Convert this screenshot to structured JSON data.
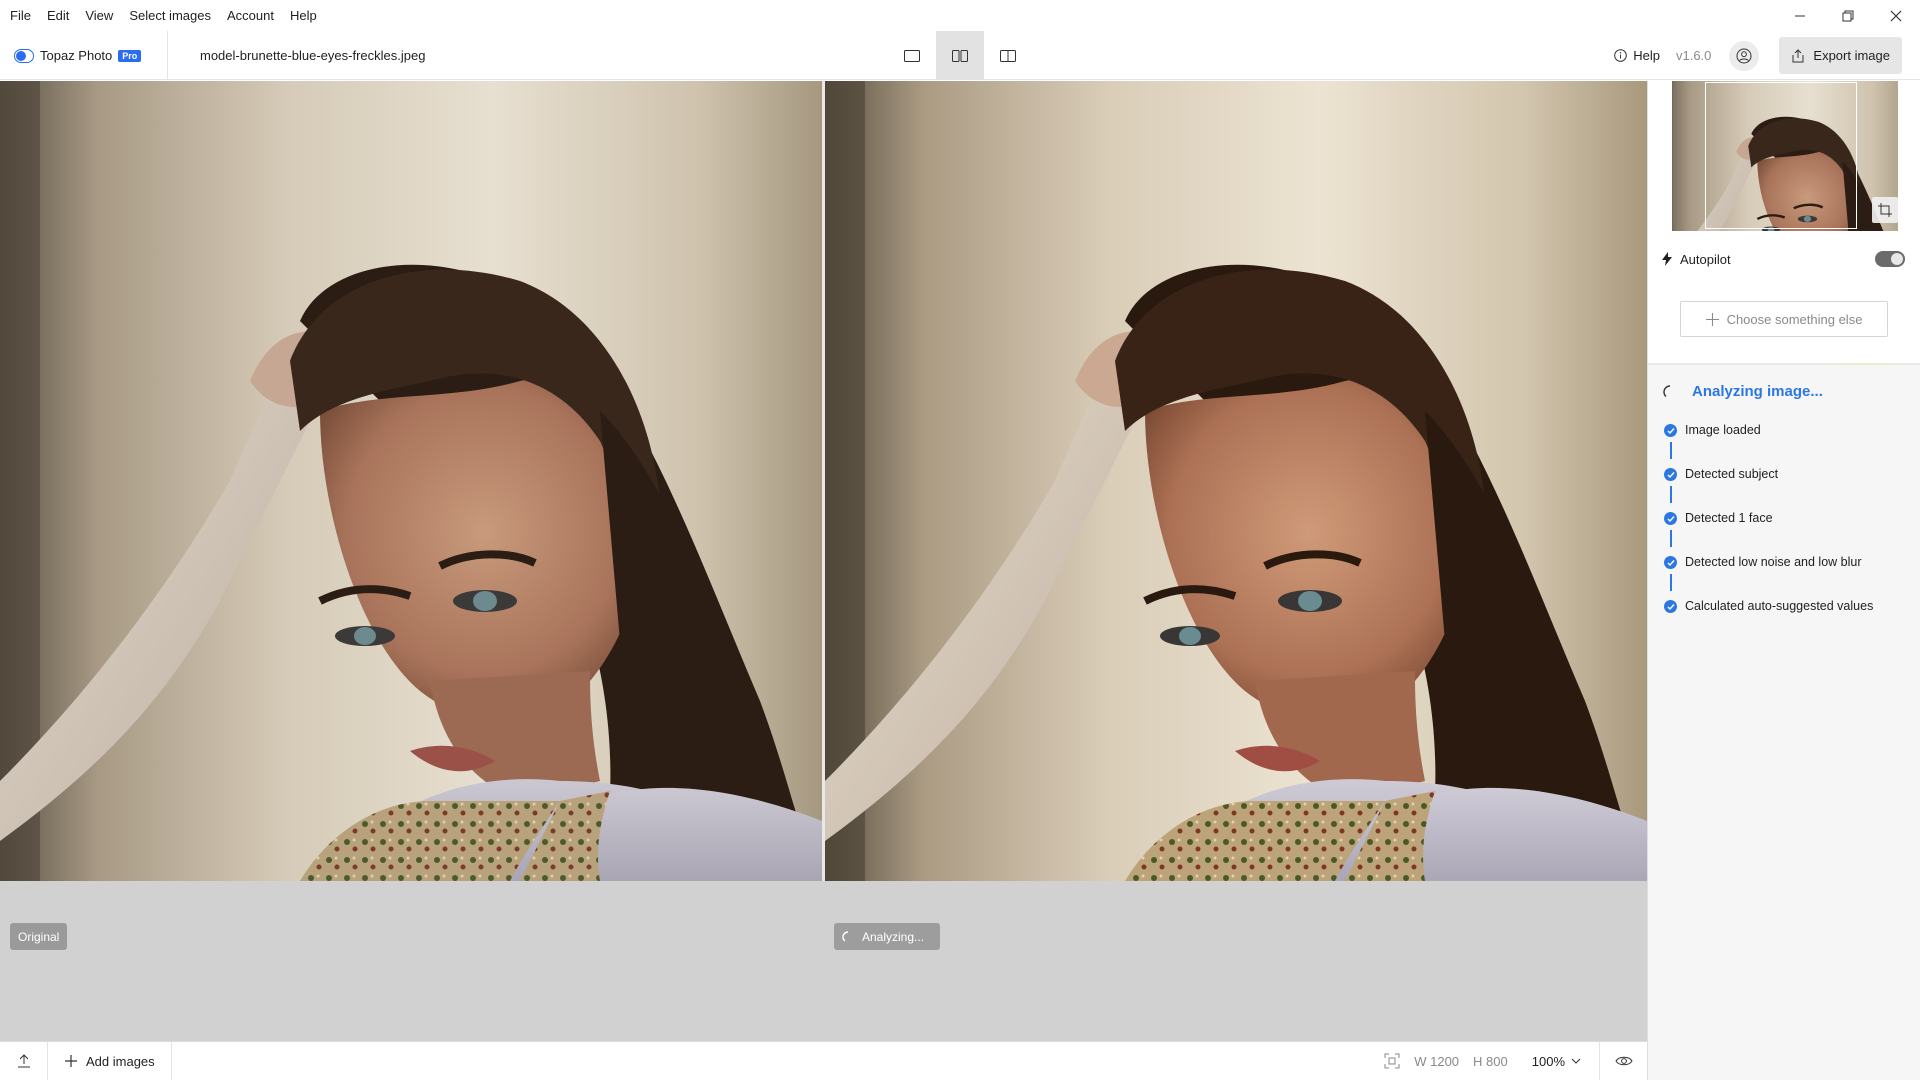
{
  "menu": [
    "File",
    "Edit",
    "View",
    "Select images",
    "Account",
    "Help"
  ],
  "window_controls": {
    "minimize": "minimize-icon",
    "restore": "restore-icon",
    "close": "close-icon"
  },
  "toolbar": {
    "app_name": "Topaz Photo",
    "app_badge": "Pro",
    "filename": "model-brunette-blue-eyes-freckles.jpeg",
    "view_modes": [
      "single-view-icon",
      "side-by-side-icon",
      "split-view-icon"
    ],
    "active_view": 1,
    "help_label": "Help",
    "version": "v1.6.0",
    "export_label": "Export image"
  },
  "canvas": {
    "original_tag": "Original",
    "processed_tag": "Analyzing..."
  },
  "bottombar": {
    "add_images_label": "Add images",
    "width": "W 1200",
    "height": "H 800",
    "zoom": "100%"
  },
  "panel": {
    "autopilot_label": "Autopilot",
    "autopilot_enabled": true,
    "choose_label": "Choose something else",
    "analyzing_title": "Analyzing image...",
    "steps": [
      {
        "label": "Image loaded",
        "done": true
      },
      {
        "label": "Detected subject",
        "done": true
      },
      {
        "label": "Detected 1 face",
        "done": true
      },
      {
        "label": "Detected low noise and low blur",
        "done": true
      },
      {
        "label": "Calculated auto-suggested values",
        "done": true
      }
    ]
  },
  "colors": {
    "accent": "#2b78e4",
    "canvas_bg": "#d1d1d1",
    "pro_badge": "#2b6df1"
  }
}
